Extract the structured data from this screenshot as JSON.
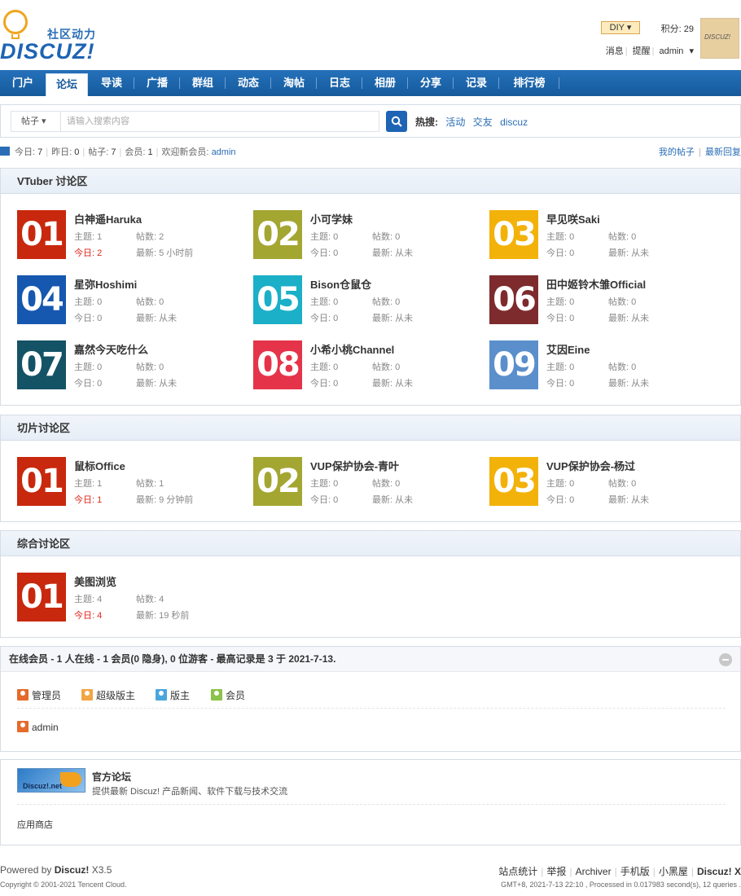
{
  "header": {
    "logo_slogan": "社区动力",
    "logo_brand": "DISCUZ!",
    "diy_label": "DIY",
    "credit_label": "积分: 29",
    "links": [
      "消息",
      "提醒",
      "admin"
    ],
    "avatar_text": "DISCUZ!"
  },
  "nav": {
    "items": [
      "门户",
      "论坛",
      "导读",
      "广播",
      "群组",
      "动态",
      "淘帖",
      "日志",
      "相册",
      "分享",
      "记录",
      "排行榜"
    ],
    "active": "论坛"
  },
  "search": {
    "type_label": "帖子",
    "placeholder": "请输入搜索内容",
    "hot_label": "热搜:",
    "hot_words": [
      "活动",
      "交友",
      "discuz"
    ]
  },
  "stats": {
    "today_label": "今日:",
    "today": "7",
    "yesterday_label": "昨日:",
    "yesterday": "0",
    "posts_label": "帖子:",
    "posts": "7",
    "members_label": "会员:",
    "members": "1",
    "welcome_label": "欢迎新会员:",
    "welcome_user": "admin",
    "my_posts": "我的帖子",
    "latest_reply": "最新回复"
  },
  "labels": {
    "topics": "主题:",
    "posts": "帖数:",
    "today": "今日:",
    "latest": "最新:"
  },
  "categories": [
    {
      "title": "VTuber 讨论区",
      "forums": [
        {
          "num": "01",
          "color": "#c8280d",
          "name": "白神遥Haruka",
          "topics": "1",
          "posts": "2",
          "today": "2",
          "latest": "5 小时前",
          "has_today": true
        },
        {
          "num": "02",
          "color": "#a4a632",
          "name": "小可学妹",
          "topics": "0",
          "posts": "0",
          "today": "0",
          "latest": "从未",
          "has_today": false
        },
        {
          "num": "03",
          "color": "#f3b20a",
          "name": "早见咲Saki",
          "topics": "0",
          "posts": "0",
          "today": "0",
          "latest": "从未",
          "has_today": false
        },
        {
          "num": "04",
          "color": "#1658b0",
          "name": "星弥Hoshimi",
          "topics": "0",
          "posts": "0",
          "today": "0",
          "latest": "从未",
          "has_today": false
        },
        {
          "num": "05",
          "color": "#1bafc8",
          "name": "Bison仓鼠仓",
          "topics": "0",
          "posts": "0",
          "today": "0",
          "latest": "从未",
          "has_today": false
        },
        {
          "num": "06",
          "color": "#7d2b2d",
          "name": "田中姬铃木雏Official",
          "topics": "0",
          "posts": "0",
          "today": "0",
          "latest": "从未",
          "has_today": false
        },
        {
          "num": "07",
          "color": "#145365",
          "name": "嘉然今天吃什么",
          "topics": "0",
          "posts": "0",
          "today": "0",
          "latest": "从未",
          "has_today": false
        },
        {
          "num": "08",
          "color": "#e5344a",
          "name": "小希小桃Channel",
          "topics": "0",
          "posts": "0",
          "today": "0",
          "latest": "从未",
          "has_today": false
        },
        {
          "num": "09",
          "color": "#5b8fcc",
          "name": "艾因Eine",
          "topics": "0",
          "posts": "0",
          "today": "0",
          "latest": "从未",
          "has_today": false
        }
      ]
    },
    {
      "title": "切片讨论区",
      "forums": [
        {
          "num": "01",
          "color": "#c8280d",
          "name": "鼠标Office",
          "topics": "1",
          "posts": "1",
          "today": "1",
          "latest": "9 分钟前",
          "has_today": true
        },
        {
          "num": "02",
          "color": "#a4a632",
          "name": "VUP保护协会-青叶",
          "topics": "0",
          "posts": "0",
          "today": "0",
          "latest": "从未",
          "has_today": false
        },
        {
          "num": "03",
          "color": "#f3b20a",
          "name": "VUP保护协会-杨过",
          "topics": "0",
          "posts": "0",
          "today": "0",
          "latest": "从未",
          "has_today": false
        }
      ]
    },
    {
      "title": "综合讨论区",
      "forums": [
        {
          "num": "01",
          "color": "#c8280d",
          "name": "美图浏览",
          "topics": "4",
          "posts": "4",
          "today": "4",
          "latest": "19 秒前",
          "has_today": true
        }
      ]
    }
  ],
  "online": {
    "title": "在线会员 - 1 人在线 - 1 会员(0 隐身), 0 位游客 - 最高记录是 3 于 2021-7-13.",
    "legend": [
      {
        "label": "管理员",
        "color": "#e56a2c"
      },
      {
        "label": "超级版主",
        "color": "#f2a544"
      },
      {
        "label": "版主",
        "color": "#48a6dd"
      },
      {
        "label": "会员",
        "color": "#8cc34a"
      }
    ],
    "users": [
      {
        "label": "admin",
        "color": "#e56a2c"
      }
    ]
  },
  "links": {
    "logo_text": "Discuz!.net",
    "name": "官方论坛",
    "desc": "提供最新 Discuz! 产品新闻、软件下载与技术交流",
    "app_store": "应用商店"
  },
  "footer": {
    "powered_prefix": "Powered by ",
    "powered_brand": "Discuz!",
    "powered_version": " X3.5",
    "copyright": "Copyright © 2001-2021 Tencent Cloud.",
    "links": [
      "站点统计",
      "举报",
      "Archiver",
      "手机版",
      "小黑屋",
      "Discuz! X"
    ],
    "status": "GMT+8, 2021-7-13 22:10 , Processed in 0.017983 second(s), 12 queries ."
  }
}
